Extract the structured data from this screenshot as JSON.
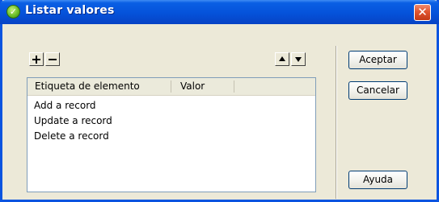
{
  "window": {
    "title": "Listar valores",
    "close_glyph": "✕"
  },
  "toolbar": {
    "add_icon": "plus-icon",
    "remove_icon": "minus-icon",
    "move_up_icon": "triangle-up-icon",
    "move_down_icon": "triangle-down-icon"
  },
  "list": {
    "columns": [
      "Etiqueta de elemento",
      "Valor"
    ],
    "rows": [
      {
        "label": "Add a record",
        "value": ""
      },
      {
        "label": "Update a record",
        "value": ""
      },
      {
        "label": "Delete a record",
        "value": ""
      }
    ]
  },
  "buttons": {
    "ok": "Aceptar",
    "cancel": "Cancelar",
    "help": "Ayuda"
  },
  "colors": {
    "titlebar": "#0552da",
    "dialog_bg": "#ece9d8",
    "close_button": "#e0552f"
  }
}
